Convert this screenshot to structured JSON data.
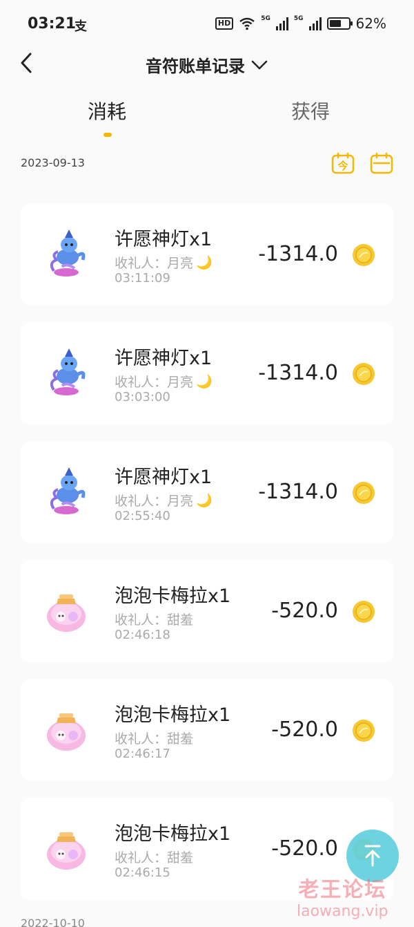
{
  "status_bar": {
    "time": "03:21",
    "notification_glyph": "支",
    "network_labels": [
      "HD",
      "5G",
      "5G"
    ],
    "battery_level": 0.62,
    "battery_text": "62%"
  },
  "nav": {
    "title": "音符账单记录"
  },
  "tabs": [
    {
      "label": "消耗",
      "active": true
    },
    {
      "label": "获得",
      "active": false
    }
  ],
  "date_group": "2023-09-13",
  "calendar_today_glyph": "今",
  "records": [
    {
      "name": "许愿神灯x1",
      "receiver": "收礼人：月亮",
      "receiver_emoji": "🌙",
      "time": "03:11:09",
      "amount": "-1314.0",
      "icon": "genie-lamp-gift-icon"
    },
    {
      "name": "许愿神灯x1",
      "receiver": "收礼人：月亮",
      "receiver_emoji": "🌙",
      "time": "03:03:00",
      "amount": "-1314.0",
      "icon": "genie-lamp-gift-icon"
    },
    {
      "name": "许愿神灯x1",
      "receiver": "收礼人：月亮",
      "receiver_emoji": "🌙",
      "time": "02:55:40",
      "amount": "-1314.0",
      "icon": "genie-lamp-gift-icon"
    },
    {
      "name": "泡泡卡梅拉x1",
      "receiver": "收礼人：甜羞",
      "receiver_emoji": "",
      "time": "02:46:18",
      "amount": "-520.0",
      "icon": "bubble-car-gift-icon"
    },
    {
      "name": "泡泡卡梅拉x1",
      "receiver": "收礼人：甜羞",
      "receiver_emoji": "",
      "time": "02:46:17",
      "amount": "-520.0",
      "icon": "bubble-car-gift-icon"
    },
    {
      "name": "泡泡卡梅拉x1",
      "receiver": "收礼人：甜羞",
      "receiver_emoji": "",
      "time": "02:46:15",
      "amount": "-520.0",
      "icon": "bubble-car-gift-icon"
    }
  ],
  "next_date_group": "2022-10-10",
  "watermark": {
    "cn": "老王论坛",
    "en": "laowang.vip"
  },
  "colors": {
    "accent": "#f5b800",
    "coin": "#f6c72f",
    "scroll_top_button": "#62d0df",
    "watermark": "#f06e78"
  }
}
